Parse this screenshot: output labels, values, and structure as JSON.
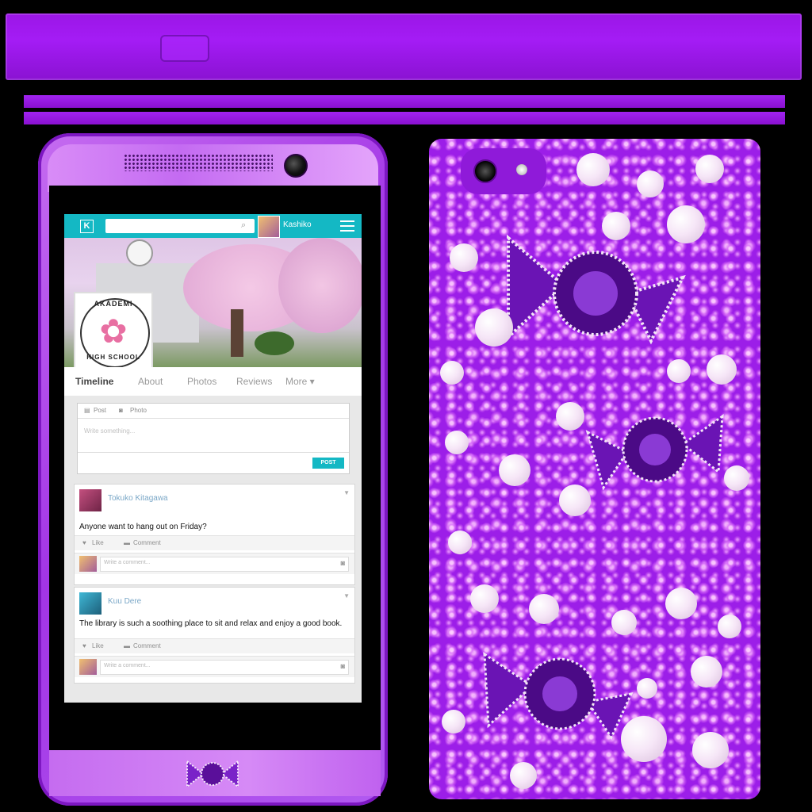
{
  "app": {
    "logo_letter": "K",
    "search_icon": "magnifier-icon",
    "username": "Kashiko",
    "school_badge": {
      "top_text": "AKADEMI",
      "bottom_text": "HIGH SCHOOL"
    },
    "tabs": [
      {
        "label": "Timeline",
        "active": true
      },
      {
        "label": "About",
        "active": false
      },
      {
        "label": "Photos",
        "active": false
      },
      {
        "label": "Reviews",
        "active": false
      },
      {
        "label": "More ▾",
        "active": false
      }
    ],
    "composer": {
      "post_option": "Post",
      "photo_option": "Photo",
      "placeholder": "Write something...",
      "post_button": "POST"
    },
    "posts": [
      {
        "author": "Tokuko Kitagawa",
        "text": "Anyone want to hang out on Friday?",
        "like_label": "Like",
        "comment_label": "Comment",
        "comment_placeholder": "Write a comment..."
      },
      {
        "author": "Kuu Dere",
        "text": "The library is such a soothing place to sit and relax and enjoy a good book.",
        "like_label": "Like",
        "comment_label": "Comment",
        "comment_placeholder": "Write a comment..."
      }
    ]
  },
  "colors": {
    "accent_teal": "#14b8c4",
    "phone_purple": "#a235e6",
    "case_purple": "#9c1ee8"
  }
}
